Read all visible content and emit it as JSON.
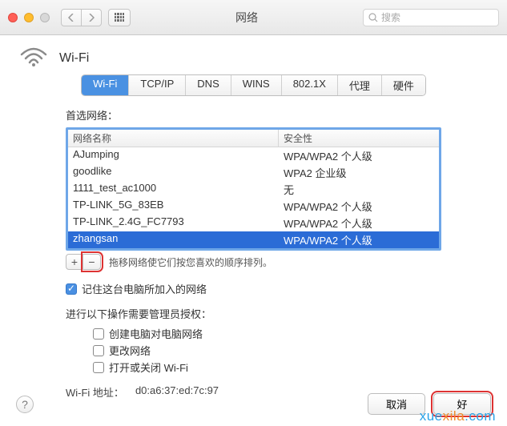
{
  "window": {
    "title": "网络"
  },
  "search": {
    "placeholder": "搜索"
  },
  "page": {
    "icon_name": "wifi-icon",
    "heading": "Wi-Fi"
  },
  "tabs": [
    {
      "label": "Wi-Fi",
      "active": true
    },
    {
      "label": "TCP/IP"
    },
    {
      "label": "DNS"
    },
    {
      "label": "WINS"
    },
    {
      "label": "802.1X"
    },
    {
      "label": "代理"
    },
    {
      "label": "硬件"
    }
  ],
  "preferred_label": "首选网络：",
  "columns": {
    "name": "网络名称",
    "security": "安全性"
  },
  "networks": [
    {
      "name": "AJumping",
      "security": "WPA/WPA2 个人级"
    },
    {
      "name": "goodlike",
      "security": "WPA2 企业级"
    },
    {
      "name": "1111_test_ac1000",
      "security": "无"
    },
    {
      "name": "TP-LINK_5G_83EB",
      "security": "WPA/WPA2 个人级"
    },
    {
      "name": "TP-LINK_2.4G_FC7793",
      "security": "WPA/WPA2 个人级"
    },
    {
      "name": "zhangsan",
      "security": "WPA/WPA2 个人级",
      "selected": true
    }
  ],
  "drag_hint": "拖移网络使它们按您喜欢的顺序排列。",
  "remember": {
    "checked": true,
    "label": "记住这台电脑所加入的网络"
  },
  "admin_label": "进行以下操作需要管理员授权：",
  "admin_opts": [
    {
      "label": "创建电脑对电脑网络",
      "checked": false
    },
    {
      "label": "更改网络",
      "checked": false
    },
    {
      "label": "打开或关闭 Wi-Fi",
      "checked": false
    }
  ],
  "address": {
    "label": "Wi-Fi 地址：",
    "value": "d0:a6:37:ed:7c:97"
  },
  "buttons": {
    "cancel": "取消",
    "ok": "好"
  },
  "watermark": {
    "a": "xue",
    "b": "xila",
    "c": ".com"
  }
}
